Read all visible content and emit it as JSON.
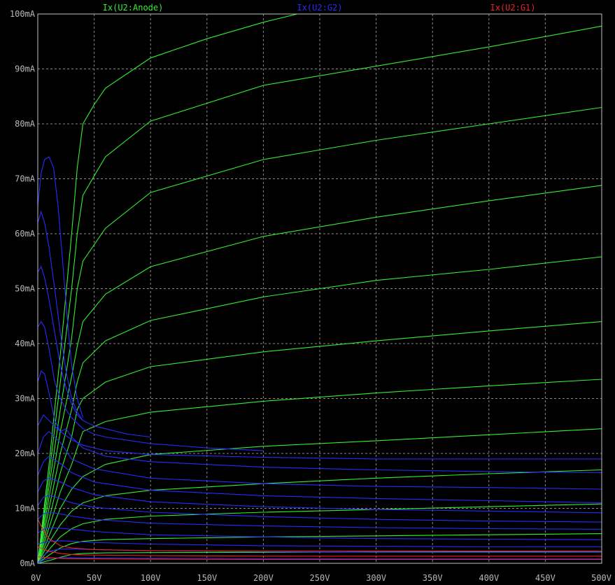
{
  "chart_data": {
    "type": "line",
    "title": "",
    "xlabel": "",
    "ylabel": "",
    "xlim": [
      0,
      500
    ],
    "ylim": [
      0,
      100
    ],
    "grid": true,
    "legend_placement": "top",
    "background_color": "#000000",
    "x_ticks": [
      0,
      50,
      100,
      150,
      200,
      250,
      300,
      350,
      400,
      450,
      500
    ],
    "x_tick_labels": [
      "0V",
      "50V",
      "100V",
      "150V",
      "200V",
      "250V",
      "300V",
      "350V",
      "400V",
      "450V",
      "500V"
    ],
    "y_ticks": [
      0,
      10,
      20,
      30,
      40,
      50,
      60,
      70,
      80,
      90,
      100
    ],
    "y_tick_labels": [
      "0mA",
      "10mA",
      "20mA",
      "30mA",
      "40mA",
      "50mA",
      "60mA",
      "70mA",
      "80mA",
      "90mA",
      "100mA"
    ],
    "series": [
      {
        "name": "Ix(U2:Anode)",
        "color": "#33ee33",
        "curves": [
          {
            "x": [
              0,
              10,
              20,
              30,
              40,
              60,
              100,
              200,
              300,
              400,
              500
            ],
            "y": [
              0,
              0.5,
              1.1,
              1.6,
              1.8,
              1.9,
              1.95,
              2.0,
              2.05,
              2.1,
              2.15
            ]
          },
          {
            "x": [
              0,
              10,
              20,
              30,
              40,
              60,
              100,
              200,
              300,
              400,
              500
            ],
            "y": [
              0,
              1.5,
              2.8,
              3.6,
              4.0,
              4.3,
              4.5,
              4.8,
              5.0,
              5.2,
              5.4
            ]
          },
          {
            "x": [
              0,
              10,
              20,
              30,
              40,
              60,
              100,
              200,
              300,
              400,
              500
            ],
            "y": [
              0,
              2.5,
              4.8,
              6.3,
              7.2,
              8.0,
              8.6,
              9.3,
              9.8,
              10.3,
              10.8
            ]
          },
          {
            "x": [
              0,
              10,
              20,
              30,
              40,
              60,
              100,
              200,
              300,
              400,
              500
            ],
            "y": [
              0,
              3.8,
              7.0,
              9.5,
              11.0,
              12.3,
              13.3,
              14.5,
              15.5,
              16.3,
              17.0
            ]
          },
          {
            "x": [
              0,
              10,
              20,
              30,
              40,
              60,
              100,
              200,
              300,
              400,
              500
            ],
            "y": [
              0,
              5.0,
              10.0,
              13.5,
              15.8,
              18.0,
              19.8,
              21.3,
              22.3,
              23.4,
              24.5
            ]
          },
          {
            "x": [
              0,
              10,
              20,
              30,
              35,
              40,
              60,
              100,
              200,
              300,
              400,
              500
            ],
            "y": [
              0,
              6.5,
              13.0,
              18.0,
              21.0,
              24.0,
              25.8,
              27.5,
              29.5,
              31.0,
              32.3,
              33.5
            ]
          },
          {
            "x": [
              0,
              10,
              20,
              30,
              35,
              40,
              60,
              100,
              200,
              300,
              400,
              500
            ],
            "y": [
              0,
              8.0,
              16.5,
              23.0,
              28.0,
              30.0,
              33.0,
              35.8,
              38.5,
              40.5,
              42.3,
              44.0
            ]
          },
          {
            "x": [
              0,
              10,
              20,
              30,
              35,
              40,
              60,
              100,
              200,
              300,
              400,
              500
            ],
            "y": [
              0,
              10.0,
              20.0,
              28.0,
              33.0,
              36.5,
              40.5,
              44.2,
              48.5,
              51.5,
              53.5,
              55.8
            ]
          },
          {
            "x": [
              0,
              10,
              20,
              30,
              35,
              40,
              60,
              100,
              200,
              300,
              400,
              500
            ],
            "y": [
              0,
              12.0,
              24.0,
              34.0,
              39.5,
              44.0,
              49.0,
              54.0,
              59.5,
              63.0,
              66.0,
              68.8
            ]
          },
          {
            "x": [
              0,
              10,
              20,
              30,
              35,
              40,
              60,
              100,
              200,
              300,
              400,
              500
            ],
            "y": [
              0,
              14.0,
              28.0,
              41.0,
              50.0,
              55.0,
              61.0,
              67.5,
              73.5,
              77.0,
              80.0,
              83.0
            ]
          },
          {
            "x": [
              0,
              10,
              20,
              30,
              35,
              40,
              60,
              100,
              200,
              300,
              400,
              500
            ],
            "y": [
              0,
              16.0,
              33.0,
              50.0,
              60.0,
              67.0,
              74.0,
              80.5,
              87.0,
              90.5,
              94.0,
              97.8
            ]
          },
          {
            "x": [
              0,
              10,
              20,
              30,
              35,
              40,
              50,
              60,
              100,
              150,
              200,
              230
            ],
            "y": [
              0,
              18.0,
              38.0,
              60.0,
              72.0,
              80.0,
              83.5,
              86.5,
              92.0,
              95.5,
              98.5,
              100.0
            ]
          }
        ]
      },
      {
        "name": "Ix(U2:G2)",
        "color": "#2a2aff",
        "curves": [
          {
            "x": [
              0,
              5,
              10,
              20,
              30,
              50,
              100,
              200,
              300,
              400,
              500
            ],
            "y": [
              0,
              0.6,
              0.9,
              1.0,
              1.0,
              0.95,
              0.9,
              0.85,
              0.8,
              0.8,
              0.8
            ]
          },
          {
            "x": [
              0,
              5,
              10,
              20,
              30,
              50,
              100,
              200,
              300,
              400,
              500
            ],
            "y": [
              0,
              1.4,
              2.2,
              2.6,
              2.6,
              2.5,
              2.3,
              2.1,
              2.0,
              2.0,
              2.0
            ]
          },
          {
            "x": [
              0,
              5,
              10,
              20,
              30,
              50,
              100,
              200,
              300,
              400,
              500
            ],
            "y": [
              3.5,
              3.8,
              4.0,
              4.1,
              4.0,
              3.8,
              3.5,
              3.2,
              3.1,
              3.0,
              3.0
            ]
          },
          {
            "x": [
              0,
              5,
              10,
              20,
              30,
              50,
              100,
              200,
              300,
              400,
              500
            ],
            "y": [
              5.5,
              6.2,
              6.5,
              6.4,
              6.2,
              5.8,
              5.2,
              4.8,
              4.5,
              4.4,
              4.3
            ]
          },
          {
            "x": [
              0,
              5,
              10,
              20,
              30,
              50,
              100,
              200,
              300,
              400,
              500
            ],
            "y": [
              8.0,
              9.0,
              9.3,
              9.0,
              8.6,
              8.0,
              7.3,
              6.8,
              6.5,
              6.3,
              6.2
            ]
          },
          {
            "x": [
              0,
              5,
              10,
              20,
              30,
              50,
              100,
              200,
              300,
              400,
              500
            ],
            "y": [
              10.5,
              12.0,
              12.4,
              11.8,
              11.0,
              10.2,
              9.3,
              8.5,
              8.0,
              7.7,
              7.5
            ]
          },
          {
            "x": [
              0,
              5,
              10,
              20,
              30,
              50,
              100,
              200,
              300,
              400,
              500
            ],
            "y": [
              13.0,
              15.0,
              15.5,
              14.8,
              13.8,
              12.5,
              11.2,
              10.3,
              9.8,
              9.5,
              9.2
            ]
          },
          {
            "x": [
              0,
              5,
              10,
              20,
              30,
              50,
              100,
              200,
              300,
              400,
              500
            ],
            "y": [
              16.0,
              18.5,
              19.5,
              18.2,
              16.5,
              14.8,
              13.3,
              12.3,
              11.8,
              11.4,
              11.0
            ]
          },
          {
            "x": [
              0,
              5,
              10,
              20,
              25,
              30,
              50,
              100,
              200,
              300,
              400,
              500
            ],
            "y": [
              20.0,
              23.0,
              24.0,
              22.0,
              20.5,
              19.0,
              17.2,
              15.5,
              14.5,
              14.0,
              13.8,
              13.5
            ]
          },
          {
            "x": [
              0,
              5,
              10,
              20,
              30,
              35,
              40,
              60,
              100,
              200,
              300,
              400,
              500
            ],
            "y": [
              25.0,
              27.0,
              26.0,
              24.0,
              22.5,
              22.0,
              21.0,
              19.5,
              18.5,
              17.5,
              17.0,
              16.7,
              16.5
            ]
          },
          {
            "x": [
              0,
              3,
              6,
              10,
              15,
              20,
              25,
              30,
              35,
              40,
              60,
              100,
              200,
              300,
              400,
              500
            ],
            "y": [
              33.0,
              35.0,
              34.5,
              31.0,
              26.0,
              24.0,
              24.5,
              23.0,
              22.0,
              21.5,
              20.5,
              19.8,
              19.3,
              19.0,
              19.0,
              19.0
            ]
          },
          {
            "x": [
              0,
              3,
              6,
              10,
              15,
              20,
              25,
              30,
              35,
              40,
              50,
              60,
              100,
              150,
              200
            ],
            "y": [
              43.0,
              44.0,
              43.0,
              39.0,
              33.0,
              30.0,
              28.0,
              26.5,
              25.5,
              24.5,
              23.5,
              23.0,
              21.8,
              21.0,
              20.5
            ]
          },
          {
            "x": [
              0,
              3,
              6,
              10,
              15,
              20,
              25,
              30,
              35,
              40,
              50,
              60,
              80,
              100
            ],
            "y": [
              53.0,
              54.0,
              52.0,
              48.0,
              42.0,
              36.0,
              32.0,
              29.0,
              27.0,
              26.0,
              25.0,
              24.5,
              23.5,
              23.0
            ]
          },
          {
            "x": [
              0,
              3,
              6,
              10,
              15,
              20,
              25,
              30,
              35,
              40
            ],
            "y": [
              62.0,
              64.0,
              62.0,
              57.5,
              50.0,
              42.0,
              35.0,
              30.0,
              27.5,
              26.0
            ]
          },
          {
            "x": [
              0,
              3,
              6,
              10,
              14,
              18,
              22,
              26,
              30,
              35,
              40
            ],
            "y": [
              65.0,
              71.0,
              73.5,
              74.0,
              72.0,
              65.0,
              55.0,
              45.0,
              36.0,
              30.0,
              26.5
            ]
          }
        ]
      },
      {
        "name": "Ix(U2:G1)",
        "color": "#ee2222",
        "curves": [
          {
            "x": [
              0,
              5,
              10,
              20,
              30,
              50,
              100,
              200,
              300,
              400,
              500
            ],
            "y": [
              8.0,
              6.0,
              4.5,
              3.2,
              2.8,
              2.5,
              2.3,
              2.2,
              2.2,
              2.2,
              2.2
            ]
          },
          {
            "x": [
              0,
              5,
              10,
              20,
              30,
              50,
              100,
              200,
              300,
              400,
              500
            ],
            "y": [
              3.0,
              2.6,
              2.2,
              1.8,
              1.6,
              1.5,
              1.4,
              1.3,
              1.3,
              1.3,
              1.3
            ]
          },
          {
            "x": [
              0,
              5,
              10,
              20,
              30,
              50,
              100,
              200,
              300,
              400,
              500
            ],
            "y": [
              1.2,
              1.1,
              1.0,
              0.9,
              0.85,
              0.8,
              0.75,
              0.7,
              0.7,
              0.7,
              0.7
            ]
          }
        ]
      }
    ]
  }
}
